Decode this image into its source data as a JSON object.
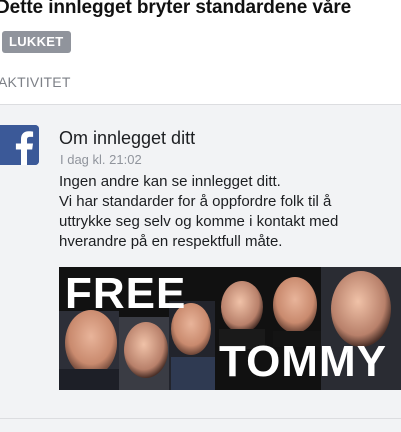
{
  "post": {
    "title": "Dette innlegget bryter standardene våre",
    "status_badge": "LUKKET"
  },
  "activity": {
    "section_label": "AKTIVITET",
    "notification": {
      "icon": "facebook-icon",
      "title": "Om innlegget ditt",
      "time": "I dag kl. 21:02",
      "body_lines": [
        "Ingen andre kan se innlegget ditt.",
        "Vi har standarder for å oppfordre folk til å",
        "uttrykke seg selv og komme i kontakt med",
        "hverandre på en respektfull måte."
      ],
      "image": {
        "text_top": "FREE",
        "text_bottom": "TOMMY"
      }
    }
  },
  "colors": {
    "facebook_blue": "#3b5998",
    "badge_gray": "#90949c",
    "card_background": "#f2f3f5"
  }
}
